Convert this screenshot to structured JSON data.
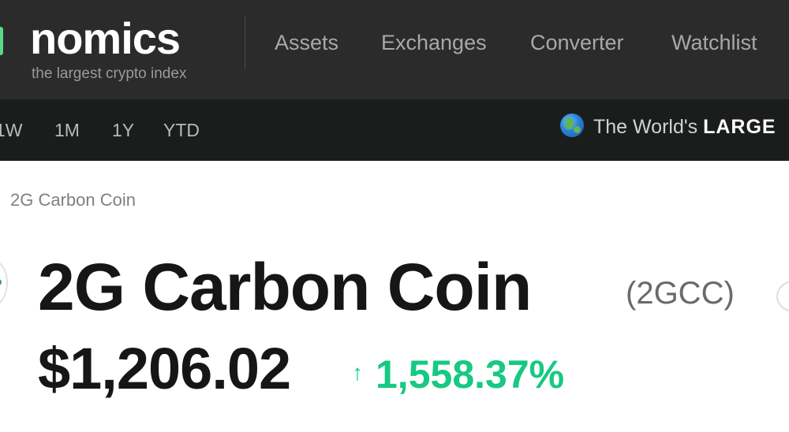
{
  "header": {
    "logo": "nomics",
    "tagline": "the largest crypto index",
    "nav": [
      {
        "label": "Assets"
      },
      {
        "label": "Exchanges"
      },
      {
        "label": "Converter"
      },
      {
        "label": "Watchlist"
      }
    ]
  },
  "subbar": {
    "ranges": [
      {
        "label": "1W"
      },
      {
        "label": "1M"
      },
      {
        "label": "1Y"
      },
      {
        "label": "YTD"
      }
    ],
    "ticker_prefix": "The World's",
    "ticker_emphasis": "LARGE"
  },
  "coin": {
    "breadcrumb": "2G Carbon Coin",
    "name": "2G Carbon Coin",
    "symbol": "(2GCC)",
    "price": "$1,206.02",
    "change_arrow": "↑",
    "change": "1,558.37%"
  },
  "colors": {
    "header_bg": "#2b2b2b",
    "subbar_bg": "#1b1c1c",
    "positive": "#17c982",
    "logo_accent": "#5cd68b"
  },
  "icons": {
    "globe": "globe-icon"
  }
}
